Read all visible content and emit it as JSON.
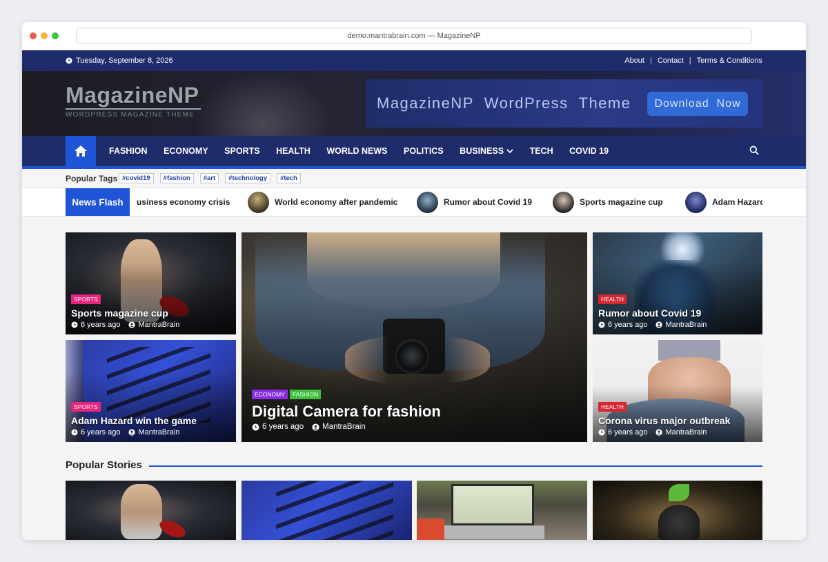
{
  "browser": {
    "url": "demo.mantrabrain.com — MagazineNP"
  },
  "topbar": {
    "date": "Tuesday, September 8, 2026",
    "links": [
      "About",
      "Contact",
      "Terms & Conditions"
    ],
    "separator": "|"
  },
  "header": {
    "logo_name": "MagazineNP",
    "logo_tagline": "WORDPRESS MAGAZINE THEME",
    "banner_text": "MagazineNP  WordPress  Theme",
    "banner_button": "Download  Now"
  },
  "nav": {
    "items": [
      "FASHION",
      "ECONOMY",
      "SPORTS",
      "HEALTH",
      "WORLD NEWS",
      "POLITICS",
      "BUSINESS",
      "TECH",
      "COVID 19"
    ]
  },
  "tags": {
    "label": "Popular Tags",
    "items": [
      "#covid19",
      "#fashion",
      "#art",
      "#technology",
      "#tech"
    ]
  },
  "news_flash": {
    "label": "News Flash",
    "items": [
      "usiness economy crisis",
      "World economy after pandemic",
      "Rumor about Covid 19",
      "Sports magazine cup",
      "Adam Hazard"
    ]
  },
  "featured": {
    "left_top": {
      "category": "SPORTS",
      "title": "Sports magazine cup",
      "time": "6 years ago",
      "author": "MantraBrain"
    },
    "left_bottom": {
      "category": "SPORTS",
      "title": "Adam Hazard win the game",
      "time": "6 years ago",
      "author": "MantraBrain"
    },
    "center": {
      "categories": [
        "ECONOMY",
        "FASHION"
      ],
      "title": "Digital Camera for fashion",
      "time": "6 years ago",
      "author": "MantraBrain"
    },
    "right_top": {
      "category": "HEALTH",
      "title": "Rumor about Covid 19",
      "time": "6 years ago",
      "author": "MantraBrain"
    },
    "right_bottom": {
      "category": "HEALTH",
      "title": "Corona virus major outbreak",
      "time": "6 years ago",
      "author": "MantraBrain"
    }
  },
  "popular": {
    "heading": "Popular Stories"
  },
  "colors": {
    "navy": "#1e2c6b",
    "accent_blue": "#1f54d6",
    "sports": "#e8237e",
    "health": "#d6262f",
    "economy": "#8a2be2",
    "fashion": "#3cbf3c"
  }
}
